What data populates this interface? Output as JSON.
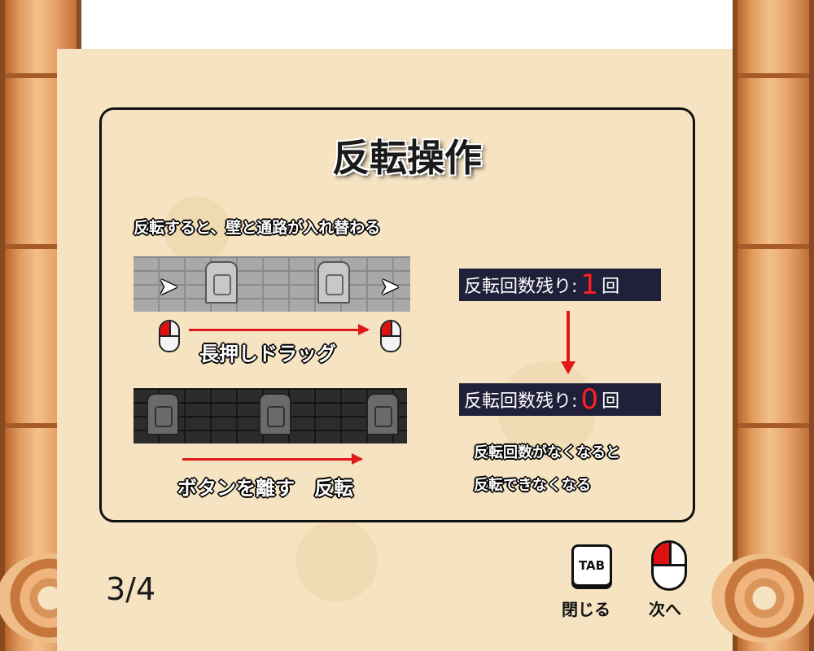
{
  "title": "反転操作",
  "description": "反転すると、壁と通路が入れ替わる",
  "step_labels": {
    "drag": "長押しドラッグ",
    "release": "ボタンを離す　反転"
  },
  "counters": [
    {
      "label": "反転回数残り:",
      "value": "1",
      "unit": "回"
    },
    {
      "label": "反転回数残り:",
      "value": "0",
      "unit": "回"
    }
  ],
  "notes": [
    "反転回数がなくなると",
    "反転できなくなる"
  ],
  "page_indicator": "3/4",
  "controls": {
    "tab_key": "TAB",
    "close_label": "閉じる",
    "next_label": "次へ"
  },
  "colors": {
    "accent_red": "#e01818",
    "counter_bg": "#20203a",
    "paper": "#f6e3c1"
  }
}
